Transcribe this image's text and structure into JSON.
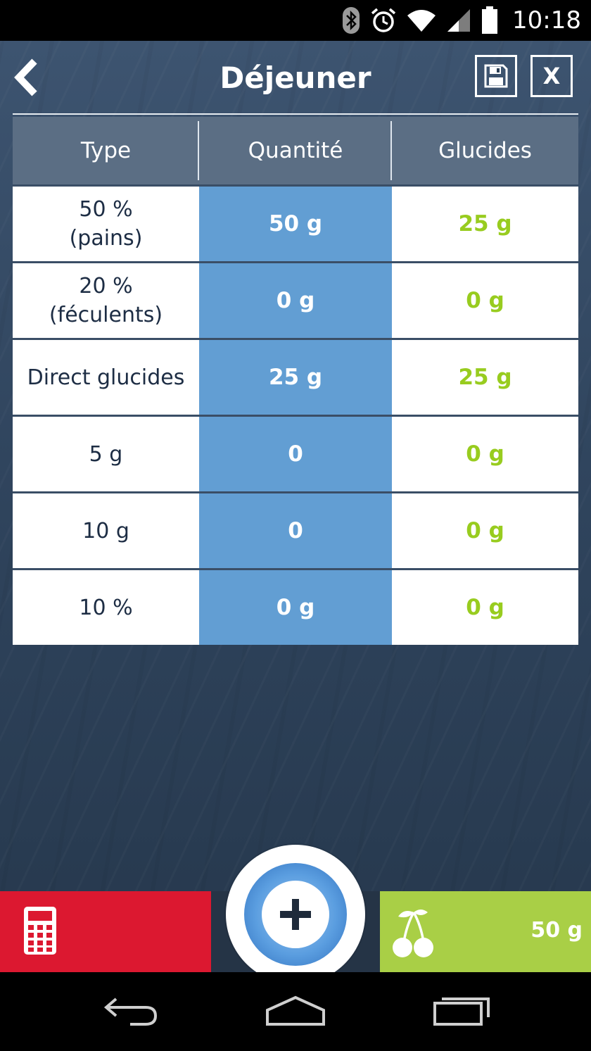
{
  "status_bar": {
    "time": "10:18",
    "icons": [
      "bluetooth-icon",
      "alarm-icon",
      "wifi-icon",
      "signal-icon",
      "battery-icon"
    ]
  },
  "header": {
    "title": "Déjeuner",
    "back_icon": "chevron-left-icon",
    "save_icon": "floppy-disk-icon",
    "close_label": "X"
  },
  "table": {
    "columns": [
      "Type",
      "Quantité",
      "Glucides"
    ],
    "rows": [
      {
        "type_line1": "50 %",
        "type_line2": "(pains)",
        "quantity": "50 g",
        "carbs": "25 g"
      },
      {
        "type_line1": "20 %",
        "type_line2": "(féculents)",
        "quantity": "0 g",
        "carbs": "0 g"
      },
      {
        "type_line1": "Direct glucides",
        "type_line2": "",
        "quantity": "25 g",
        "carbs": "25 g"
      },
      {
        "type_line1": "5 g",
        "type_line2": "",
        "quantity": "0",
        "carbs": "0 g"
      },
      {
        "type_line1": "10 g",
        "type_line2": "",
        "quantity": "0",
        "carbs": "0 g"
      },
      {
        "type_line1": "10 %",
        "type_line2": "",
        "quantity": "0 g",
        "carbs": "0 g"
      }
    ]
  },
  "bottom_bar": {
    "calculator_icon": "calculator-icon",
    "add_icon": "plus-icon",
    "cherry_icon": "cherry-icon",
    "carbs_total": "50 g"
  },
  "colors": {
    "accent_red": "#dc1830",
    "accent_green": "#a9cf46",
    "quantity_blue": "#629ed3",
    "carbs_text_green": "#98cc1f"
  }
}
